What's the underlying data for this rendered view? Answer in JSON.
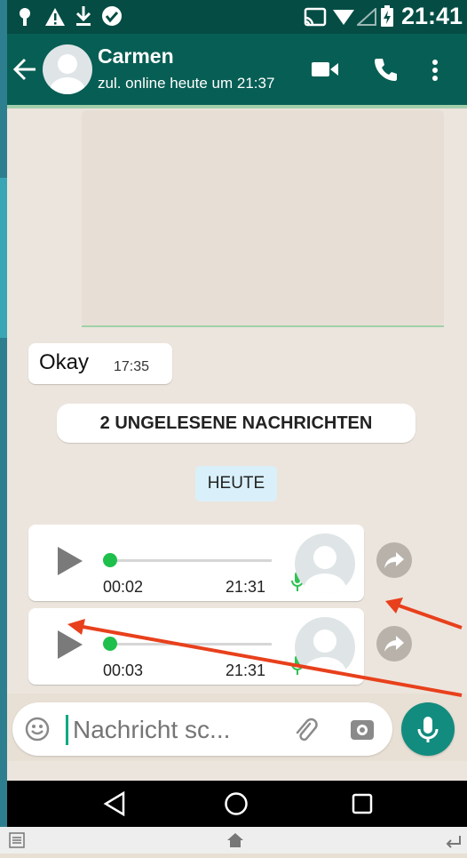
{
  "status_bar": {
    "time": "21:41"
  },
  "header": {
    "contact_name": "Carmen",
    "last_seen": "zul. online heute um 21:37"
  },
  "messages": {
    "okay_text": "Okay",
    "okay_time": "17:35",
    "unread_banner": "2 UNGELESENE NACHRICHTEN",
    "date_chip": "HEUTE",
    "voice": [
      {
        "duration": "00:02",
        "time": "21:31"
      },
      {
        "duration": "00:03",
        "time": "21:31"
      }
    ]
  },
  "composer": {
    "placeholder": "Nachricht sc..."
  },
  "colors": {
    "header": "#075e54",
    "accent": "#00a884",
    "fab": "#128c7e",
    "annotation_arrow": "#e8401c"
  }
}
